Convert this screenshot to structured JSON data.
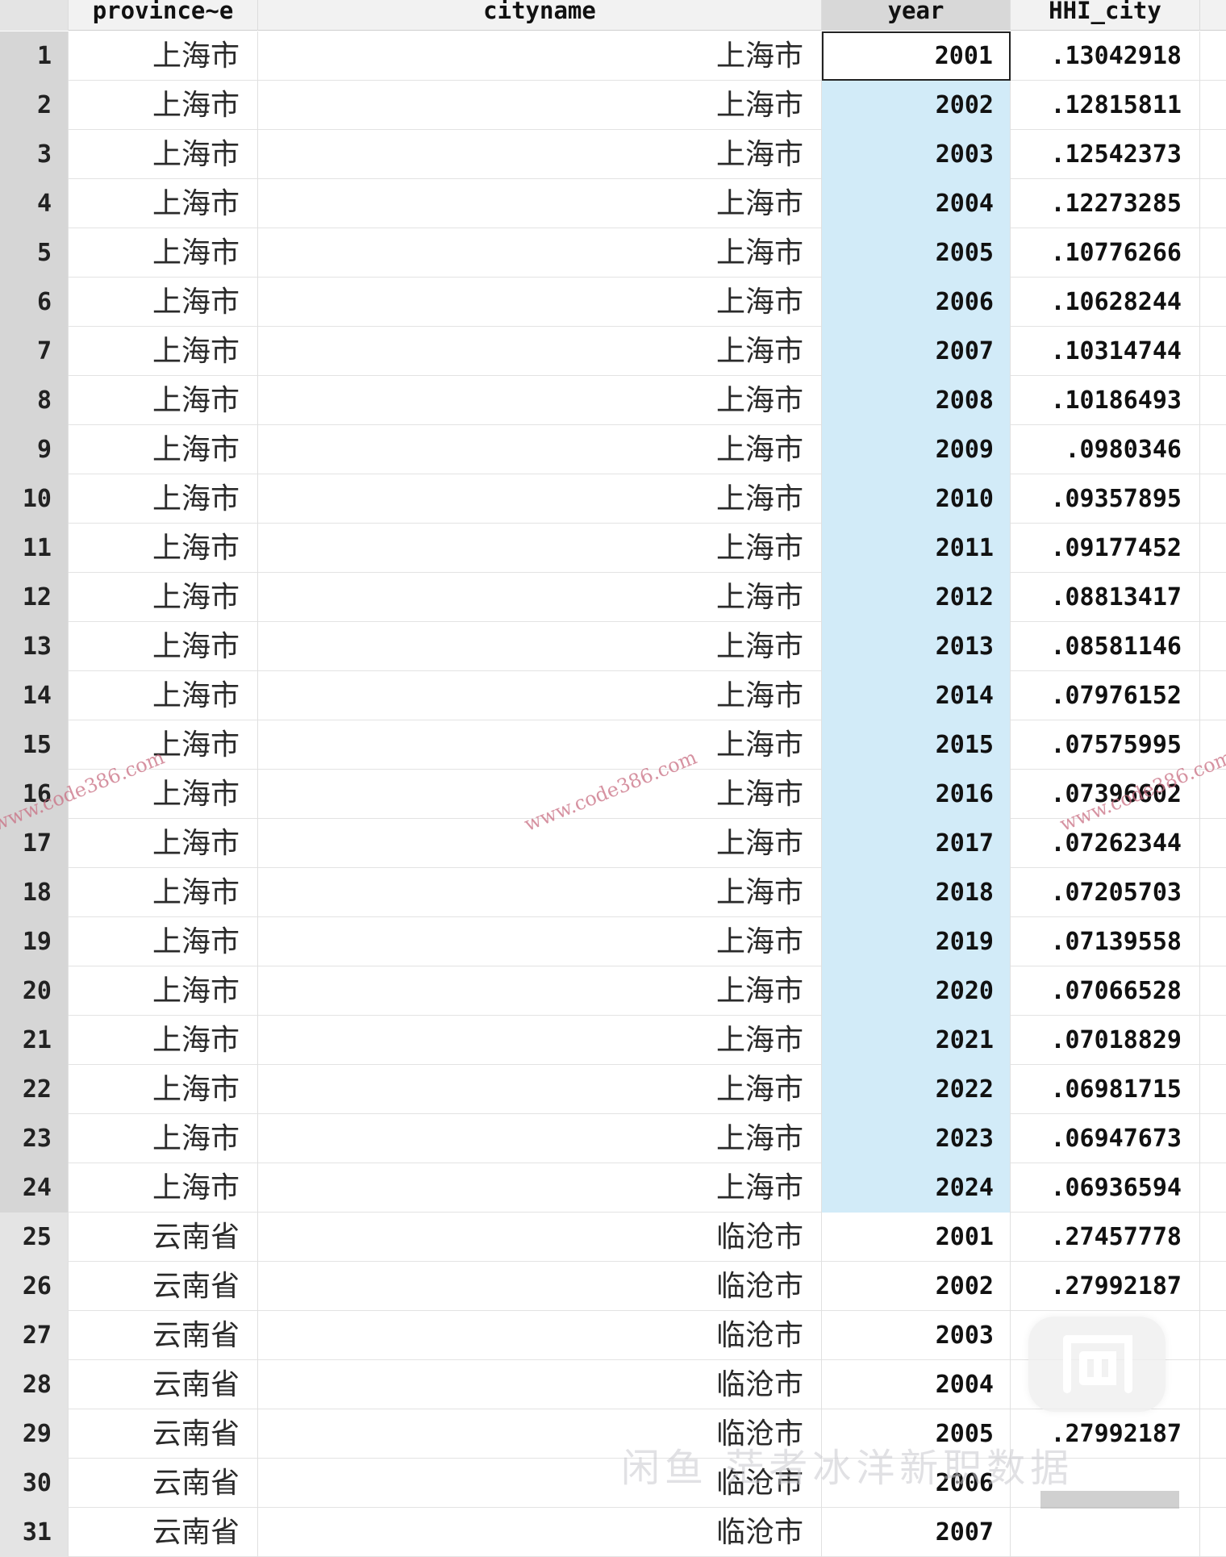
{
  "columns": {
    "index": "",
    "province": "province~e",
    "cityname": "cityname",
    "year": "year",
    "hhi": "HHI_city"
  },
  "rows": [
    {
      "idx": "1",
      "province": "上海市",
      "city": "上海市",
      "year": "2001",
      "hhi": ".13042918"
    },
    {
      "idx": "2",
      "province": "上海市",
      "city": "上海市",
      "year": "2002",
      "hhi": ".12815811"
    },
    {
      "idx": "3",
      "province": "上海市",
      "city": "上海市",
      "year": "2003",
      "hhi": ".12542373"
    },
    {
      "idx": "4",
      "province": "上海市",
      "city": "上海市",
      "year": "2004",
      "hhi": ".12273285"
    },
    {
      "idx": "5",
      "province": "上海市",
      "city": "上海市",
      "year": "2005",
      "hhi": ".10776266"
    },
    {
      "idx": "6",
      "province": "上海市",
      "city": "上海市",
      "year": "2006",
      "hhi": ".10628244"
    },
    {
      "idx": "7",
      "province": "上海市",
      "city": "上海市",
      "year": "2007",
      "hhi": ".10314744"
    },
    {
      "idx": "8",
      "province": "上海市",
      "city": "上海市",
      "year": "2008",
      "hhi": ".10186493"
    },
    {
      "idx": "9",
      "province": "上海市",
      "city": "上海市",
      "year": "2009",
      "hhi": ".0980346"
    },
    {
      "idx": "10",
      "province": "上海市",
      "city": "上海市",
      "year": "2010",
      "hhi": ".09357895"
    },
    {
      "idx": "11",
      "province": "上海市",
      "city": "上海市",
      "year": "2011",
      "hhi": ".09177452"
    },
    {
      "idx": "12",
      "province": "上海市",
      "city": "上海市",
      "year": "2012",
      "hhi": ".08813417"
    },
    {
      "idx": "13",
      "province": "上海市",
      "city": "上海市",
      "year": "2013",
      "hhi": ".08581146"
    },
    {
      "idx": "14",
      "province": "上海市",
      "city": "上海市",
      "year": "2014",
      "hhi": ".07976152"
    },
    {
      "idx": "15",
      "province": "上海市",
      "city": "上海市",
      "year": "2015",
      "hhi": ".07575995"
    },
    {
      "idx": "16",
      "province": "上海市",
      "city": "上海市",
      "year": "2016",
      "hhi": ".07396602"
    },
    {
      "idx": "17",
      "province": "上海市",
      "city": "上海市",
      "year": "2017",
      "hhi": ".07262344"
    },
    {
      "idx": "18",
      "province": "上海市",
      "city": "上海市",
      "year": "2018",
      "hhi": ".07205703"
    },
    {
      "idx": "19",
      "province": "上海市",
      "city": "上海市",
      "year": "2019",
      "hhi": ".07139558"
    },
    {
      "idx": "20",
      "province": "上海市",
      "city": "上海市",
      "year": "2020",
      "hhi": ".07066528"
    },
    {
      "idx": "21",
      "province": "上海市",
      "city": "上海市",
      "year": "2021",
      "hhi": ".07018829"
    },
    {
      "idx": "22",
      "province": "上海市",
      "city": "上海市",
      "year": "2022",
      "hhi": ".06981715"
    },
    {
      "idx": "23",
      "province": "上海市",
      "city": "上海市",
      "year": "2023",
      "hhi": ".06947673"
    },
    {
      "idx": "24",
      "province": "上海市",
      "city": "上海市",
      "year": "2024",
      "hhi": ".06936594"
    },
    {
      "idx": "25",
      "province": "云南省",
      "city": "临沧市",
      "year": "2001",
      "hhi": ".27457778"
    },
    {
      "idx": "26",
      "province": "云南省",
      "city": "临沧市",
      "year": "2002",
      "hhi": ".27992187"
    },
    {
      "idx": "27",
      "province": "云南省",
      "city": "临沧市",
      "year": "2003",
      "hhi": ""
    },
    {
      "idx": "28",
      "province": "云南省",
      "city": "临沧市",
      "year": "2004",
      "hhi": ""
    },
    {
      "idx": "29",
      "province": "云南省",
      "city": "临沧市",
      "year": "2005",
      "hhi": ".27992187"
    },
    {
      "idx": "30",
      "province": "云南省",
      "city": "临沧市",
      "year": "2006",
      "hhi": ""
    },
    {
      "idx": "31",
      "province": "云南省",
      "city": "临沧市",
      "year": "2007",
      "hhi": ""
    }
  ],
  "selection": {
    "active_row": 1,
    "selected_rows": "1-24",
    "selected_column": "year"
  },
  "watermarks": {
    "site": "www.code386.com",
    "site_clipped_left": "www.code386.com",
    "site_clipped_right": "www.code386.com",
    "signature": "闲鱼 茫者冰洋新职数据"
  },
  "colors": {
    "header_bg": "#f2f2f2",
    "index_bg": "#e4e4e4",
    "selected_bg": "#d2ebf8",
    "watermark": "#c86e82"
  },
  "icons": {
    "logo": "xianyu-logo-icon"
  }
}
